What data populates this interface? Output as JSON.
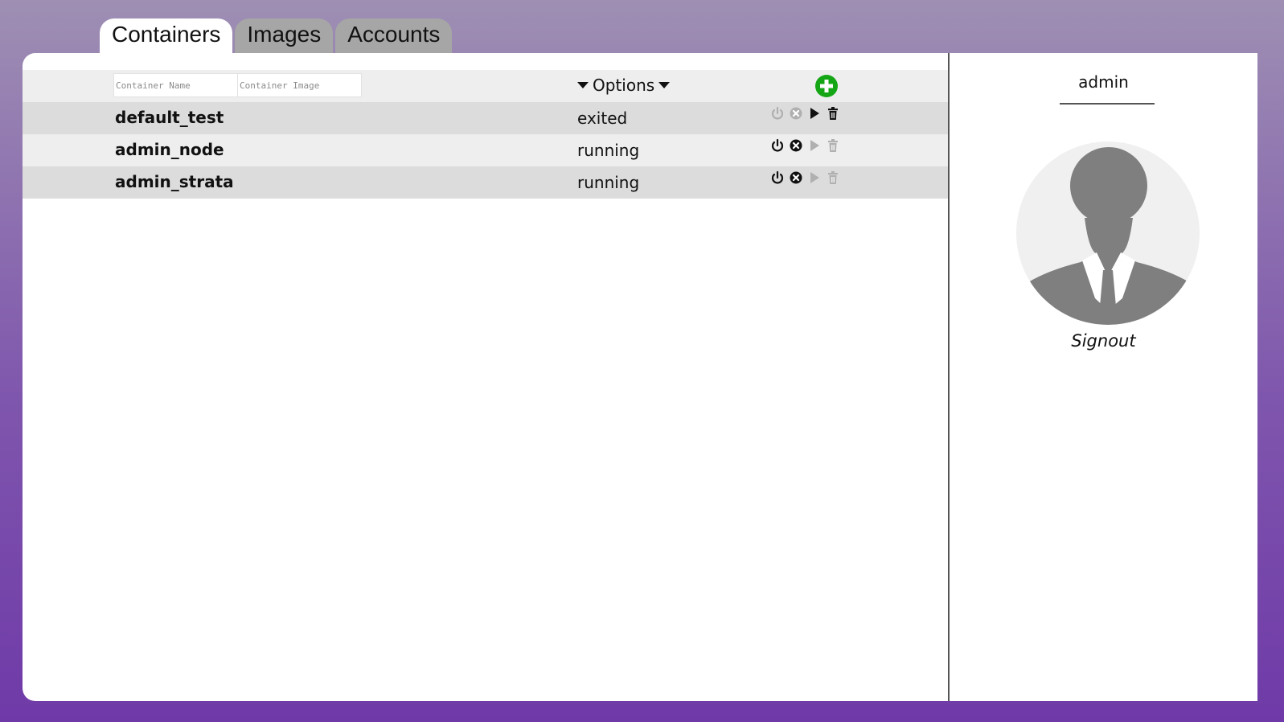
{
  "tabs": [
    {
      "label": "Containers",
      "active": true
    },
    {
      "label": "Images",
      "active": false
    },
    {
      "label": "Accounts",
      "active": false
    }
  ],
  "filters": {
    "name_placeholder": "Container Name",
    "image_placeholder": "Container Image",
    "options_label": "Options"
  },
  "containers": [
    {
      "name": "default_test",
      "status": "exited",
      "actions": {
        "stop": false,
        "kill": false,
        "start": true,
        "delete": true
      }
    },
    {
      "name": "admin_node",
      "status": "running",
      "actions": {
        "stop": true,
        "kill": true,
        "start": false,
        "delete": false
      }
    },
    {
      "name": "admin_strata",
      "status": "running",
      "actions": {
        "stop": true,
        "kill": true,
        "start": false,
        "delete": false
      }
    }
  ],
  "user": {
    "name": "admin",
    "signout_label": "Signout"
  },
  "colors": {
    "add_button": "#15a615",
    "enabled_icon": "#111111",
    "disabled_icon": "#b0b0b0",
    "avatar": "#7f7f7f"
  },
  "icons": {
    "add": "plus-circle-icon",
    "stop": "power-icon",
    "kill": "x-circle-icon",
    "start": "play-icon",
    "delete": "trash-icon"
  }
}
